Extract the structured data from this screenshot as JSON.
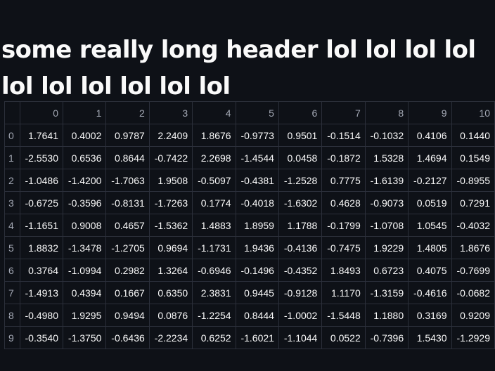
{
  "header": {
    "title": "some really long header lol lol lol lol lol lol lol lol lol lol"
  },
  "table": {
    "columns": [
      "0",
      "1",
      "2",
      "3",
      "4",
      "5",
      "6",
      "7",
      "8",
      "9",
      "10"
    ],
    "rows": [
      {
        "index": "0",
        "values": [
          "1.7641",
          "0.4002",
          "0.9787",
          "2.2409",
          "1.8676",
          "-0.9773",
          "0.9501",
          "-0.1514",
          "-0.1032",
          "0.4106",
          "0.1440"
        ]
      },
      {
        "index": "1",
        "values": [
          "-2.5530",
          "0.6536",
          "0.8644",
          "-0.7422",
          "2.2698",
          "-1.4544",
          "0.0458",
          "-0.1872",
          "1.5328",
          "1.4694",
          "0.1549"
        ]
      },
      {
        "index": "2",
        "values": [
          "-1.0486",
          "-1.4200",
          "-1.7063",
          "1.9508",
          "-0.5097",
          "-0.4381",
          "-1.2528",
          "0.7775",
          "-1.6139",
          "-0.2127",
          "-0.8955"
        ]
      },
      {
        "index": "3",
        "values": [
          "-0.6725",
          "-0.3596",
          "-0.8131",
          "-1.7263",
          "0.1774",
          "-0.4018",
          "-1.6302",
          "0.4628",
          "-0.9073",
          "0.0519",
          "0.7291"
        ]
      },
      {
        "index": "4",
        "values": [
          "-1.1651",
          "0.9008",
          "0.4657",
          "-1.5362",
          "1.4883",
          "1.8959",
          "1.1788",
          "-0.1799",
          "-1.0708",
          "1.0545",
          "-0.4032"
        ]
      },
      {
        "index": "5",
        "values": [
          "1.8832",
          "-1.3478",
          "-1.2705",
          "0.9694",
          "-1.1731",
          "1.9436",
          "-0.4136",
          "-0.7475",
          "1.9229",
          "1.4805",
          "1.8676"
        ]
      },
      {
        "index": "6",
        "values": [
          "0.3764",
          "-1.0994",
          "0.2982",
          "1.3264",
          "-0.6946",
          "-0.1496",
          "-0.4352",
          "1.8493",
          "0.6723",
          "0.4075",
          "-0.7699"
        ]
      },
      {
        "index": "7",
        "values": [
          "-1.4913",
          "0.4394",
          "0.1667",
          "0.6350",
          "2.3831",
          "0.9445",
          "-0.9128",
          "1.1170",
          "-1.3159",
          "-0.4616",
          "-0.0682"
        ]
      },
      {
        "index": "8",
        "values": [
          "-0.4980",
          "1.9295",
          "0.9494",
          "0.0876",
          "-1.2254",
          "0.8444",
          "-1.0002",
          "-1.5448",
          "1.1880",
          "0.3169",
          "0.9209"
        ]
      },
      {
        "index": "9",
        "values": [
          "-0.3540",
          "-1.3750",
          "-0.6436",
          "-2.2234",
          "0.6252",
          "-1.6021",
          "-1.1044",
          "0.0522",
          "-0.7396",
          "1.5430",
          "-1.2929"
        ]
      }
    ]
  }
}
